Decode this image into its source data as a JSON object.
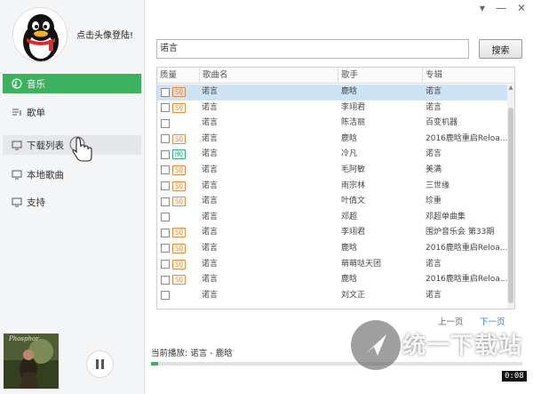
{
  "window": {
    "controls": [
      "▾",
      "—",
      "✕"
    ]
  },
  "sidebar": {
    "login_label": "点击头像登陆!",
    "items": [
      {
        "label": "音乐",
        "icon": "music-icon",
        "state": "active"
      },
      {
        "label": "歌单",
        "icon": "playlist-icon",
        "state": "normal"
      },
      {
        "label": "下载列表",
        "icon": "download-list-icon",
        "state": "hover"
      },
      {
        "label": "本地歌曲",
        "icon": "local-music-icon",
        "state": "normal"
      },
      {
        "label": "支持",
        "icon": "support-icon",
        "state": "normal"
      }
    ],
    "album_art_label": "Phosphor",
    "accent_color": "#3cb25f"
  },
  "search": {
    "value": "诺言",
    "button_label": "搜索"
  },
  "table": {
    "columns": [
      "质量",
      "歌曲名",
      "歌手",
      "专辑"
    ],
    "rows": [
      {
        "quality": "SQ",
        "name": "诺言",
        "artist": "鹿晗",
        "album": "诺言",
        "selected": true
      },
      {
        "quality": "SQ",
        "name": "诺言",
        "artist": "李翊君",
        "album": "诺言",
        "selected": false
      },
      {
        "quality": "",
        "name": "诺言",
        "artist": "陈洁丽",
        "album": "百变机器",
        "selected": false
      },
      {
        "quality": "SQ",
        "name": "诺言",
        "artist": "鹿晗",
        "album": "2016鹿晗重启Reloa...",
        "selected": false
      },
      {
        "quality": "HQ",
        "name": "诺言",
        "artist": "冷凡",
        "album": "诺言",
        "selected": false
      },
      {
        "quality": "SQ",
        "name": "诺言",
        "artist": "毛阿敏",
        "album": "美满",
        "selected": false
      },
      {
        "quality": "SQ",
        "name": "诺言",
        "artist": "雨宗林",
        "album": "三世缘",
        "selected": false
      },
      {
        "quality": "SQ",
        "name": "诺言",
        "artist": "叶倩文",
        "album": "珍重",
        "selected": false
      },
      {
        "quality": "",
        "name": "诺言",
        "artist": "邓超",
        "album": "邓超单曲集",
        "selected": false
      },
      {
        "quality": "SQ",
        "name": "诺言",
        "artist": "李翊君",
        "album": "围炉音乐会 第33期",
        "selected": false
      },
      {
        "quality": "SQ",
        "name": "诺言",
        "artist": "鹿晗",
        "album": "2016鹿晗重启Reloa...",
        "selected": false
      },
      {
        "quality": "SQ",
        "name": "诺言",
        "artist": "萌萌哒天团",
        "album": "诺言",
        "selected": false
      },
      {
        "quality": "SQ",
        "name": "诺言",
        "artist": "鹿晗",
        "album": "2016鹿晗重启Reloa...",
        "selected": false
      },
      {
        "quality": "",
        "name": "诺言",
        "artist": "刘文正",
        "album": "诺言",
        "selected": false
      }
    ]
  },
  "pagination": {
    "prev_label": "上一页",
    "next_label": "下一页"
  },
  "player": {
    "now_playing": "当前播放: 诺言 - 鹿晗",
    "progress": 0.02,
    "time": "0:08"
  },
  "watermark": {
    "text": "统一下载站"
  }
}
